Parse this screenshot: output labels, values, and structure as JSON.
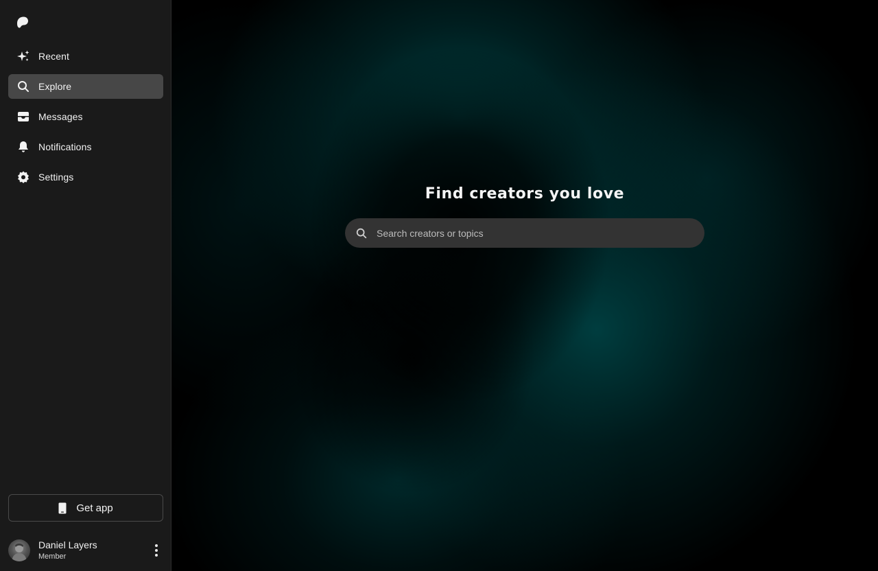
{
  "sidebar": {
    "logo_icon": "patreon-logo-icon",
    "items": [
      {
        "label": "Recent",
        "icon": "sparkle-icon",
        "active": false
      },
      {
        "label": "Explore",
        "icon": "search-icon",
        "active": true
      },
      {
        "label": "Messages",
        "icon": "inbox-icon",
        "active": false
      },
      {
        "label": "Notifications",
        "icon": "bell-icon",
        "active": false
      },
      {
        "label": "Settings",
        "icon": "gear-icon",
        "active": false
      }
    ],
    "get_app_label": "Get app",
    "user": {
      "name": "Daniel Layers",
      "role": "Member"
    }
  },
  "main": {
    "title": "Find creators you love",
    "search": {
      "placeholder": "Search creators or topics",
      "value": ""
    }
  },
  "colors": {
    "sidebar_bg": "#1a1a1a",
    "active_item_bg": "#474747",
    "search_bg": "#333333",
    "accent_teal": "#004a4c"
  }
}
